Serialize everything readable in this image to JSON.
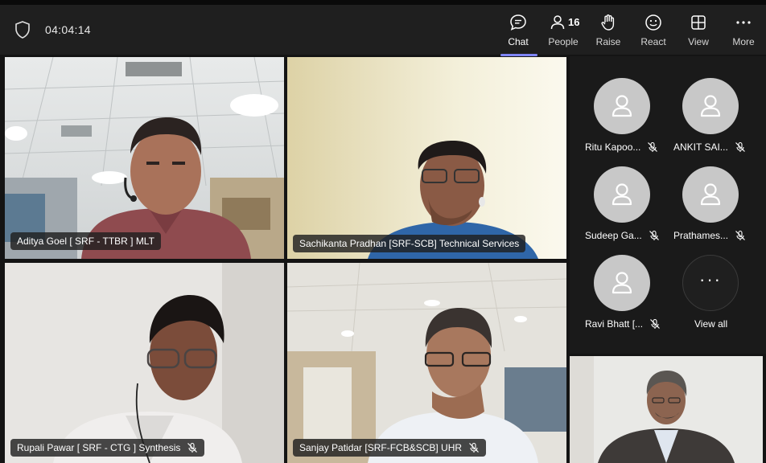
{
  "toolbar": {
    "timer": "04:04:14",
    "buttons": [
      {
        "label": "Chat",
        "icon": "chat-icon"
      },
      {
        "label": "People",
        "icon": "people-icon",
        "count": "16"
      },
      {
        "label": "Raise",
        "icon": "raise-hand-icon"
      },
      {
        "label": "React",
        "icon": "react-icon"
      },
      {
        "label": "View",
        "icon": "view-icon"
      },
      {
        "label": "More",
        "icon": "more-icon"
      }
    ]
  },
  "videos": [
    {
      "name": "Aditya Goel [ SRF - TTBR ] MLT"
    },
    {
      "name": "Sachikanta Pradhan [SRF-SCB] Technical Services"
    },
    {
      "name": "Rupali Pawar [ SRF - CTG ] Synthesis"
    },
    {
      "name": "Sanjay Patidar [SRF-FCB&SCB] UHR"
    }
  ],
  "roster": {
    "participants": [
      {
        "name": "Ritu Kapoo..."
      },
      {
        "name": "ANKIT SAI..."
      },
      {
        "name": "Sudeep Ga..."
      },
      {
        "name": "Prathames..."
      },
      {
        "name": "Ravi Bhatt [..."
      }
    ],
    "view_all": "View all"
  },
  "colors": {
    "accent": "#7f85f5",
    "toolbar_bg": "#1f1f1f",
    "background": "#141414"
  }
}
